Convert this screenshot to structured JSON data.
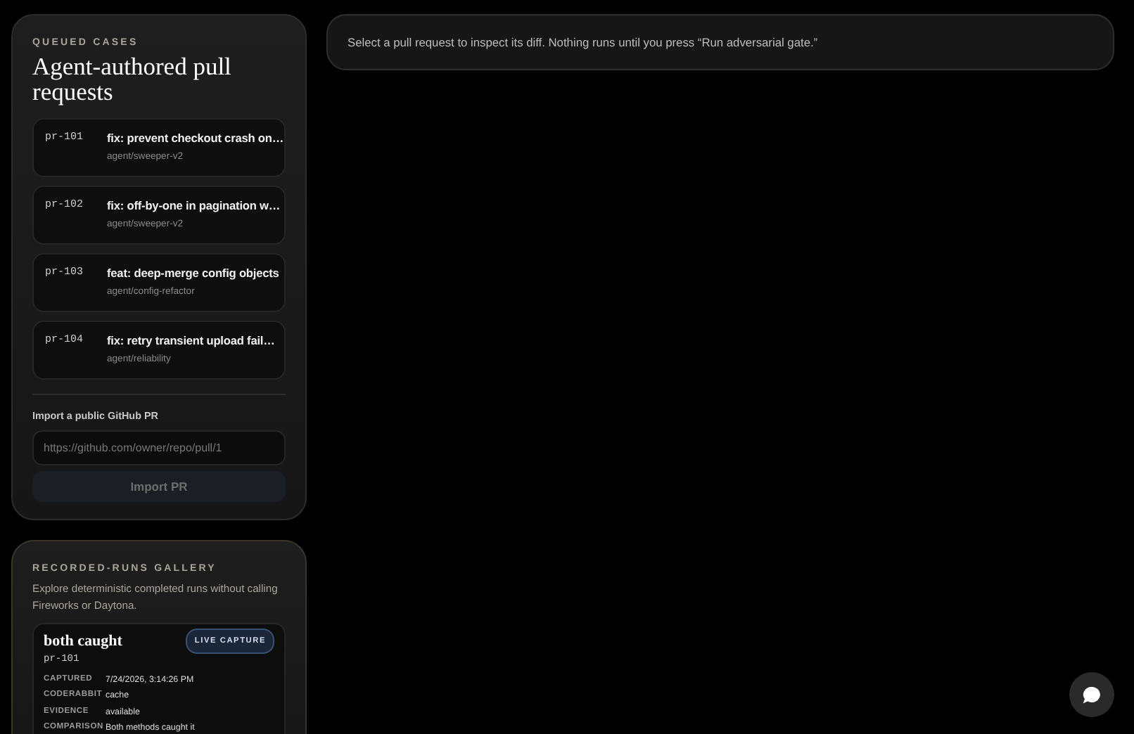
{
  "queue": {
    "eyebrow": "QUEUED CASES",
    "title": "Agent-authored pull requests",
    "items": [
      {
        "id": "pr-101",
        "title": "fix: prevent checkout crash on…",
        "branch": "agent/sweeper-v2"
      },
      {
        "id": "pr-102",
        "title": "fix: off-by-one in pagination w…",
        "branch": "agent/sweeper-v2"
      },
      {
        "id": "pr-103",
        "title": "feat: deep-merge config objects",
        "branch": "agent/config-refactor"
      },
      {
        "id": "pr-104",
        "title": "fix: retry transient upload fail…",
        "branch": "agent/reliability"
      }
    ],
    "import": {
      "label": "Import a public GitHub PR",
      "placeholder": "https://github.com/owner/repo/pull/1",
      "button": "Import PR",
      "disabled": true
    }
  },
  "gallery": {
    "eyebrow": "RECORDED-RUNS GALLERY",
    "description": "Explore deterministic completed runs without calling Fireworks or Daytona.",
    "runs": [
      {
        "title": "both caught",
        "badge": "LIVE CAPTURE",
        "id": "pr-101",
        "fields": [
          {
            "label": "CAPTURED",
            "value": "7/24/2026, 3:14:26 PM"
          },
          {
            "label": "CODERABBIT",
            "value": "cache"
          },
          {
            "label": "EVIDENCE",
            "value": "available"
          },
          {
            "label": "COMPARISON",
            "value": "Both methods caught it"
          }
        ]
      }
    ]
  },
  "notice": "Select a pull request to inspect its diff. Nothing runs until you press “Run adversarial gate.”"
}
